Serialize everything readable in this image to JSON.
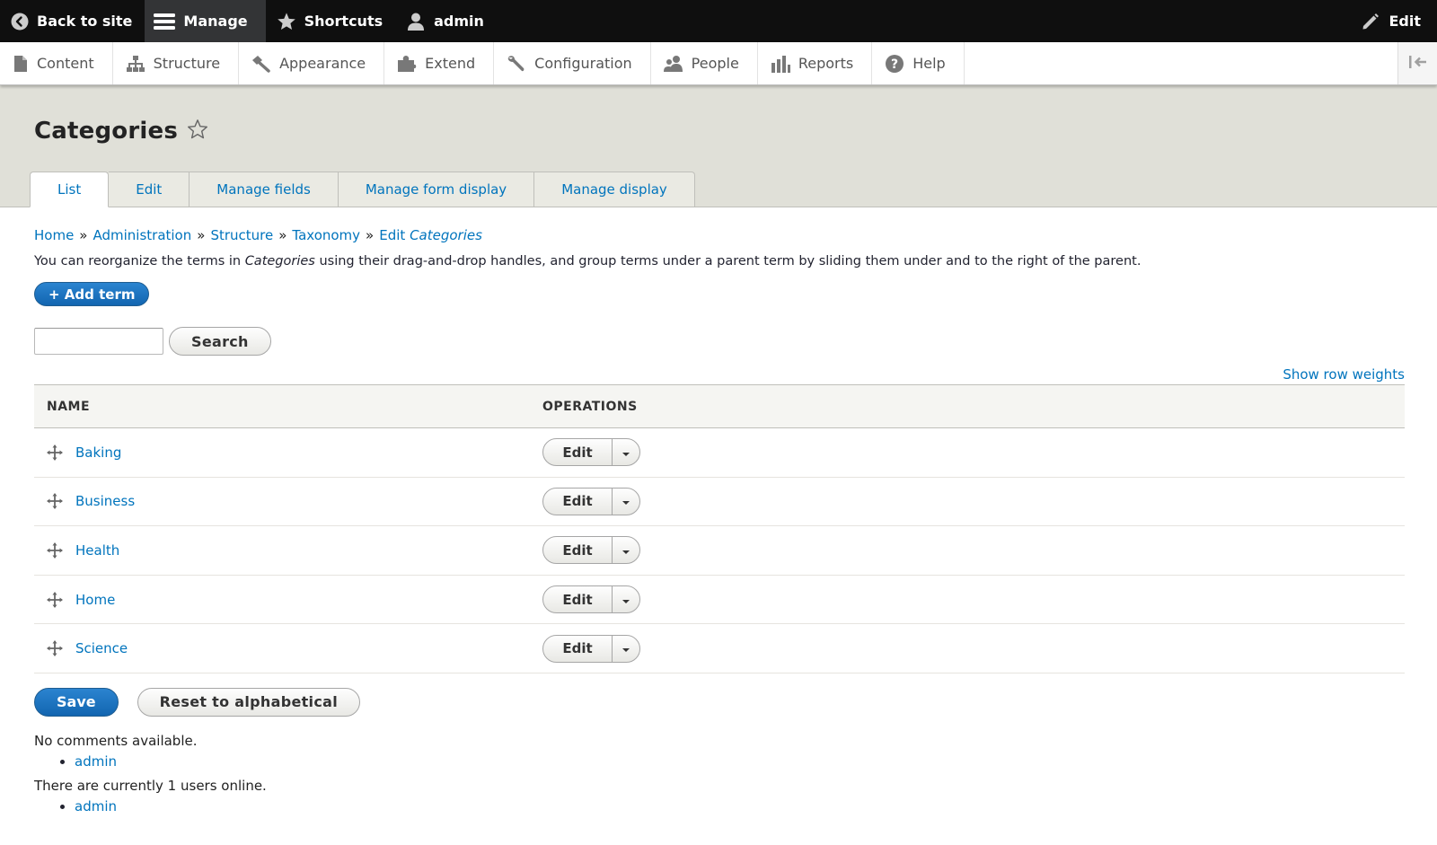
{
  "toolbar": {
    "back_label": "Back to site",
    "manage_label": "Manage",
    "shortcuts_label": "Shortcuts",
    "user_label": "admin",
    "edit_label": "Edit"
  },
  "tray": {
    "items": [
      {
        "label": "Content",
        "icon": "file-icon"
      },
      {
        "label": "Structure",
        "icon": "sitemap-icon"
      },
      {
        "label": "Appearance",
        "icon": "paintbrush-icon"
      },
      {
        "label": "Extend",
        "icon": "puzzle-icon"
      },
      {
        "label": "Configuration",
        "icon": "wrench-icon"
      },
      {
        "label": "People",
        "icon": "people-icon"
      },
      {
        "label": "Reports",
        "icon": "bar-chart-icon"
      },
      {
        "label": "Help",
        "icon": "question-icon"
      }
    ]
  },
  "page": {
    "title": "Categories",
    "tabs": [
      "List",
      "Edit",
      "Manage fields",
      "Manage form display",
      "Manage display"
    ],
    "active_tab": "List"
  },
  "breadcrumb": {
    "items": [
      "Home",
      "Administration",
      "Structure",
      "Taxonomy"
    ],
    "last_prefix": "Edit",
    "last_em": "Categories",
    "separator": "»"
  },
  "description": {
    "before": "You can reorganize the terms in",
    "em": "Categories",
    "after": "using their drag-and-drop handles, and group terms under a parent term by sliding them under and to the right of the parent."
  },
  "add_term_label": "+ Add term",
  "search": {
    "value": "",
    "button_label": "Search"
  },
  "show_row_weights_label": "Show row weights",
  "table": {
    "headers": [
      "NAME",
      "OPERATIONS"
    ],
    "rows": [
      {
        "name": "Baking",
        "operation": "Edit"
      },
      {
        "name": "Business",
        "operation": "Edit"
      },
      {
        "name": "Health",
        "operation": "Edit"
      },
      {
        "name": "Home",
        "operation": "Edit"
      },
      {
        "name": "Science",
        "operation": "Edit"
      }
    ]
  },
  "actions": {
    "save_label": "Save",
    "reset_label": "Reset to alphabetical"
  },
  "footer": {
    "comments_text": "No comments available.",
    "comments_users": [
      "admin"
    ],
    "online_text": "There are currently 1 users online.",
    "online_users": [
      "admin"
    ]
  },
  "colors": {
    "toolbar_bg": "#0f0f0f",
    "link": "#0074bd",
    "primary_button": "#1265b0",
    "header_bg": "#e0e0d8"
  }
}
